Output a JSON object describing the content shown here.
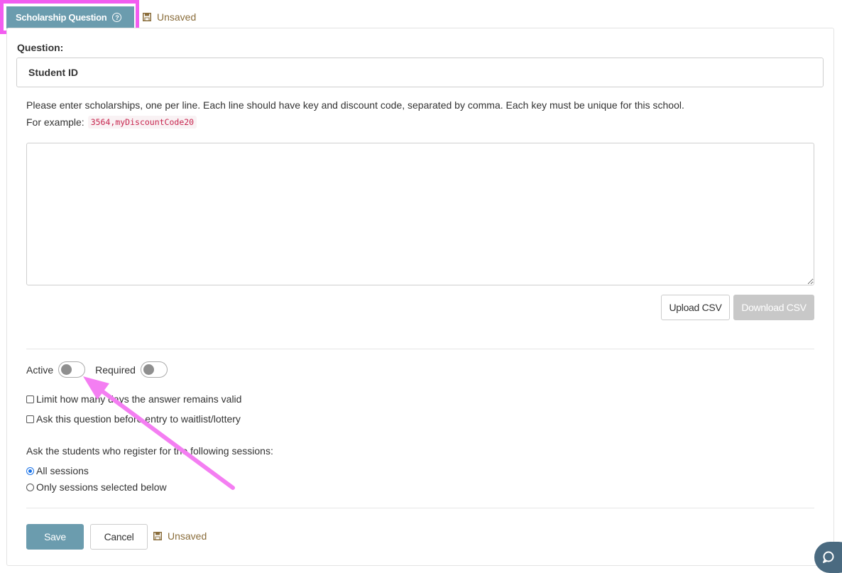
{
  "tab": {
    "title": "Scholarship Question",
    "help_icon": "?"
  },
  "status": {
    "unsaved_label": "Unsaved",
    "icon": "save-icon"
  },
  "question": {
    "label": "Question:",
    "value": "Student ID"
  },
  "instructions": {
    "text": "Please enter scholarships, one per line. Each line should have key and discount code, separated by comma. Each key must be unique for this school.",
    "example_prefix": "For example:",
    "example_code": "3564,myDiscountCode20"
  },
  "scholarships_text": "",
  "buttons": {
    "upload_csv": "Upload CSV",
    "download_csv": "Download CSV",
    "save": "Save",
    "cancel": "Cancel"
  },
  "toggles": {
    "active": {
      "label": "Active",
      "on": false
    },
    "required": {
      "label": "Required",
      "on": false
    }
  },
  "checkboxes": [
    {
      "label": "Limit how many days the answer remains valid",
      "checked": false
    },
    {
      "label": "Ask this question before entry to waitlist/lottery",
      "checked": false
    }
  ],
  "sessions": {
    "label": "Ask the students who register for the following sessions:",
    "options": [
      {
        "label": "All sessions",
        "selected": true
      },
      {
        "label": "Only sessions selected below",
        "selected": false
      }
    ]
  },
  "colors": {
    "primary": "#6b9cae",
    "highlight": "#f25cf0",
    "warning": "#8a6d3b",
    "disabled": "#c8c8c8"
  },
  "chat_widget": {
    "icon": "chat-bubble-icon"
  }
}
